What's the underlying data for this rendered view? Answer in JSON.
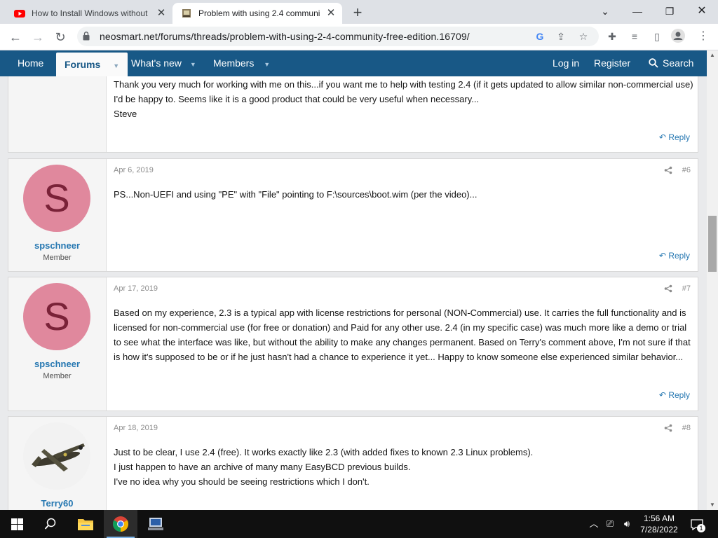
{
  "browser": {
    "tabs": [
      {
        "title": "How to Install Windows without"
      },
      {
        "title": "Problem with using 2.4 communi"
      }
    ],
    "url": "neosmart.net/forums/threads/problem-with-using-2-4-community-free-edition.16709/"
  },
  "site_nav": {
    "left": [
      "Home",
      "Forums",
      "What's new",
      "Members"
    ],
    "right": {
      "login": "Log in",
      "register": "Register",
      "search": "Search"
    }
  },
  "posts": [
    {
      "body": [
        "Thank you very much for working with me on this...if you want me to help with testing 2.4 (if it gets updated to allow similar non-commercial use) I'd be happy to. Seems like it is a good product that could be very useful when necessary...",
        "Steve"
      ],
      "reply": "Reply"
    },
    {
      "avatar_letter": "S",
      "username": "spschneer",
      "role": "Member",
      "date": "Apr 6, 2019",
      "number": "#6",
      "body": [
        "PS...Non-UEFI and using \"PE\" with \"File\" pointing to F:\\sources\\boot.wim (per the video)..."
      ],
      "reply": "Reply"
    },
    {
      "avatar_letter": "S",
      "username": "spschneer",
      "role": "Member",
      "date": "Apr 17, 2019",
      "number": "#7",
      "body": [
        "Based on my experience, 2.3 is a typical app with license restrictions for personal (NON-Commercial) use. It carries the full functionality and is licensed for non-commercial use (for free or donation) and Paid for any other use. 2.4 (in my specific case) was much more like a demo or trial to see what the interface was like, but without the ability to make any changes permanent. Based on Terry's comment above, I'm not sure if that is how it's supposed to be or if he just hasn't had a chance to experience it yet... Happy to know someone else experienced similar behavior..."
      ],
      "reply": "Reply"
    },
    {
      "username": "Terry60",
      "date": "Apr 18, 2019",
      "number": "#8",
      "body": [
        "Just to be clear, I use 2.4 (free). It works exactly like 2.3 (with added fixes to known 2.3 Linux problems).",
        "I just happen to have an archive of many many EasyBCD previous builds.",
        "I've no idea why you should be seeing restrictions which I don't."
      ]
    }
  ],
  "taskbar": {
    "time": "1:56 AM",
    "date": "7/28/2022",
    "notification_count": "1"
  },
  "colors": {
    "nav_bg": "#185886",
    "link": "#2577b1",
    "avatar_s": "#e0889d"
  }
}
